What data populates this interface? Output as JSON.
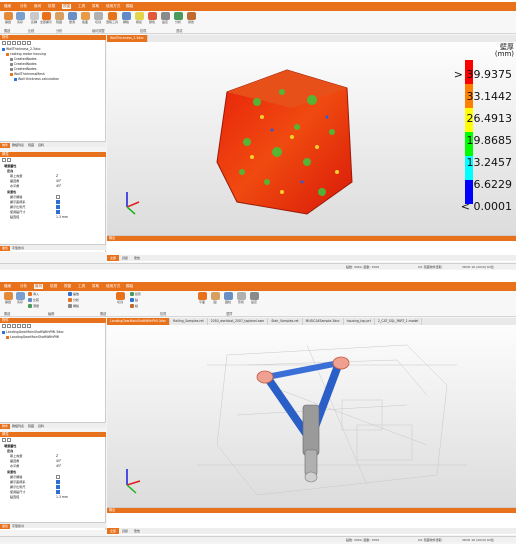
{
  "menu_labels": [
    "檔案",
    "分析",
    "幾何",
    "檢視",
    "視窗",
    "工具",
    "幫助",
    "使用方式",
    "模組"
  ],
  "menu_top_labels": [
    "檔案",
    "分析",
    "幾何",
    "檢視",
    "視窗",
    "工具",
    "幫助",
    "使用方式",
    "模組"
  ],
  "window1": {
    "ribbon_buttons": [
      "開啟",
      "另存",
      "反轉",
      "全部顯示",
      "隱藏",
      "量測",
      "截面",
      "切割",
      "選取工具",
      "網格",
      "標記",
      "顏色",
      "設定",
      "分析",
      "報告",
      "取消",
      "裁切"
    ],
    "group_labels": [
      "開啟",
      "比較",
      "分析",
      "幾何調整",
      "檢視",
      "選項"
    ],
    "objects_panel_title": "物件",
    "tree": [
      "WallThickness_2.3dxc",
      "casting-motor housing",
      "CreatedNodes",
      "CreatedNodes",
      "CreatedNodes",
      "WallThicknessMesh",
      "Wall thickness calculation"
    ],
    "panel_tabs": [
      "物件",
      "群組列表",
      "隱藏",
      "資料"
    ],
    "properties_title": "屬性",
    "props": [
      {
        "key": "場景屬性",
        "value": "",
        "section": true
      },
      {
        "key": "定向",
        "value": "",
        "section": true
      },
      {
        "key": "朝上向量",
        "value": "Z"
      },
      {
        "key": "垂直角",
        "value": "45°"
      },
      {
        "key": "水平角",
        "value": "45°"
      },
      {
        "key": "背景色",
        "value": "",
        "section": true
      },
      {
        "key": "顯示網格",
        "value": ""
      },
      {
        "key": "顯示座標系",
        "value": ""
      },
      {
        "key": "顯示比例尺",
        "value": ""
      },
      {
        "key": "使用點尺寸",
        "value": ""
      },
      {
        "key": "點直徑",
        "value": "1.3 mm"
      }
    ],
    "bottom_tabs": [
      "屬性",
      "字型搜尋"
    ],
    "doc_tab": "WallThickness_2.3dxc",
    "legend_header": [
      "壁厚",
      "(mm)"
    ],
    "legend_values": [
      "> 39.9375",
      "33.1442",
      "26.4913",
      "19.8685",
      "13.2457",
      "6.6229",
      "< 0.0001"
    ],
    "legend_colors": [
      "#ff0000",
      "#ff8000",
      "#ffff00",
      "#00ff00",
      "#00ffff",
      "#0000ff",
      "#8000ff"
    ],
    "output_title": "輸出",
    "output_tabs": [
      "全部",
      "資訊",
      "警告"
    ],
    "status": [
      "點數: 3062, 面數: 1506",
      "0/1 隱藏物件選取",
      "3DVR 16 (2019) 64位"
    ]
  },
  "window2": {
    "ribbon_buttons": [
      "開啟",
      "另存",
      "導入",
      "比較",
      "測量",
      "縮放",
      "分析",
      "網格",
      "切割",
      "投影",
      "點",
      "線",
      "平面",
      "圓",
      "圓柱",
      "形狀",
      "設定"
    ],
    "group_labels": [
      "開啟",
      "編輯",
      "開啟",
      "檢視",
      "選擇"
    ],
    "objects_panel_title": "物件",
    "tree": [
      "LandingGearMainShaftWithPMI.3dxc",
      "LandingGearMainShaftWithPMI"
    ],
    "panel_tabs": [
      "物件",
      "群組列表",
      "隱藏",
      "資料"
    ],
    "properties_title": "屬性",
    "props": [
      {
        "key": "場景屬性",
        "value": "",
        "section": true
      },
      {
        "key": "定向",
        "value": "",
        "section": true
      },
      {
        "key": "朝上向量",
        "value": "Z"
      },
      {
        "key": "垂直角",
        "value": "45°"
      },
      {
        "key": "水平角",
        "value": "45°"
      },
      {
        "key": "背景色",
        "value": "",
        "section": true
      },
      {
        "key": "顯示網格",
        "value": ""
      },
      {
        "key": "顯示座標系",
        "value": ""
      },
      {
        "key": "顯示比例尺",
        "value": ""
      },
      {
        "key": "使用點尺寸",
        "value": ""
      },
      {
        "key": "點直徑",
        "value": "1.3 mm"
      }
    ],
    "bottom_tabs": [
      "屬性",
      "字型搜尋"
    ],
    "doc_tabs": [
      "LandingGearMainShaftWithPMI.3dxc",
      "Railing_Samples.ret",
      "2050_worldcat_2007_toplevel.asm",
      "Stair_Samples.ret",
      "MUSICAESample.3dxc",
      "housing_top.prt",
      "2_CAT_SQL_PART_1.model"
    ],
    "output_title": "輸出",
    "output_tabs": [
      "全部",
      "資訊",
      "警告"
    ],
    "status": [
      "點數: 3062, 面數: 1506",
      "0/1 隱藏物件選取",
      "3DVR 16 (2019) 64位"
    ]
  }
}
